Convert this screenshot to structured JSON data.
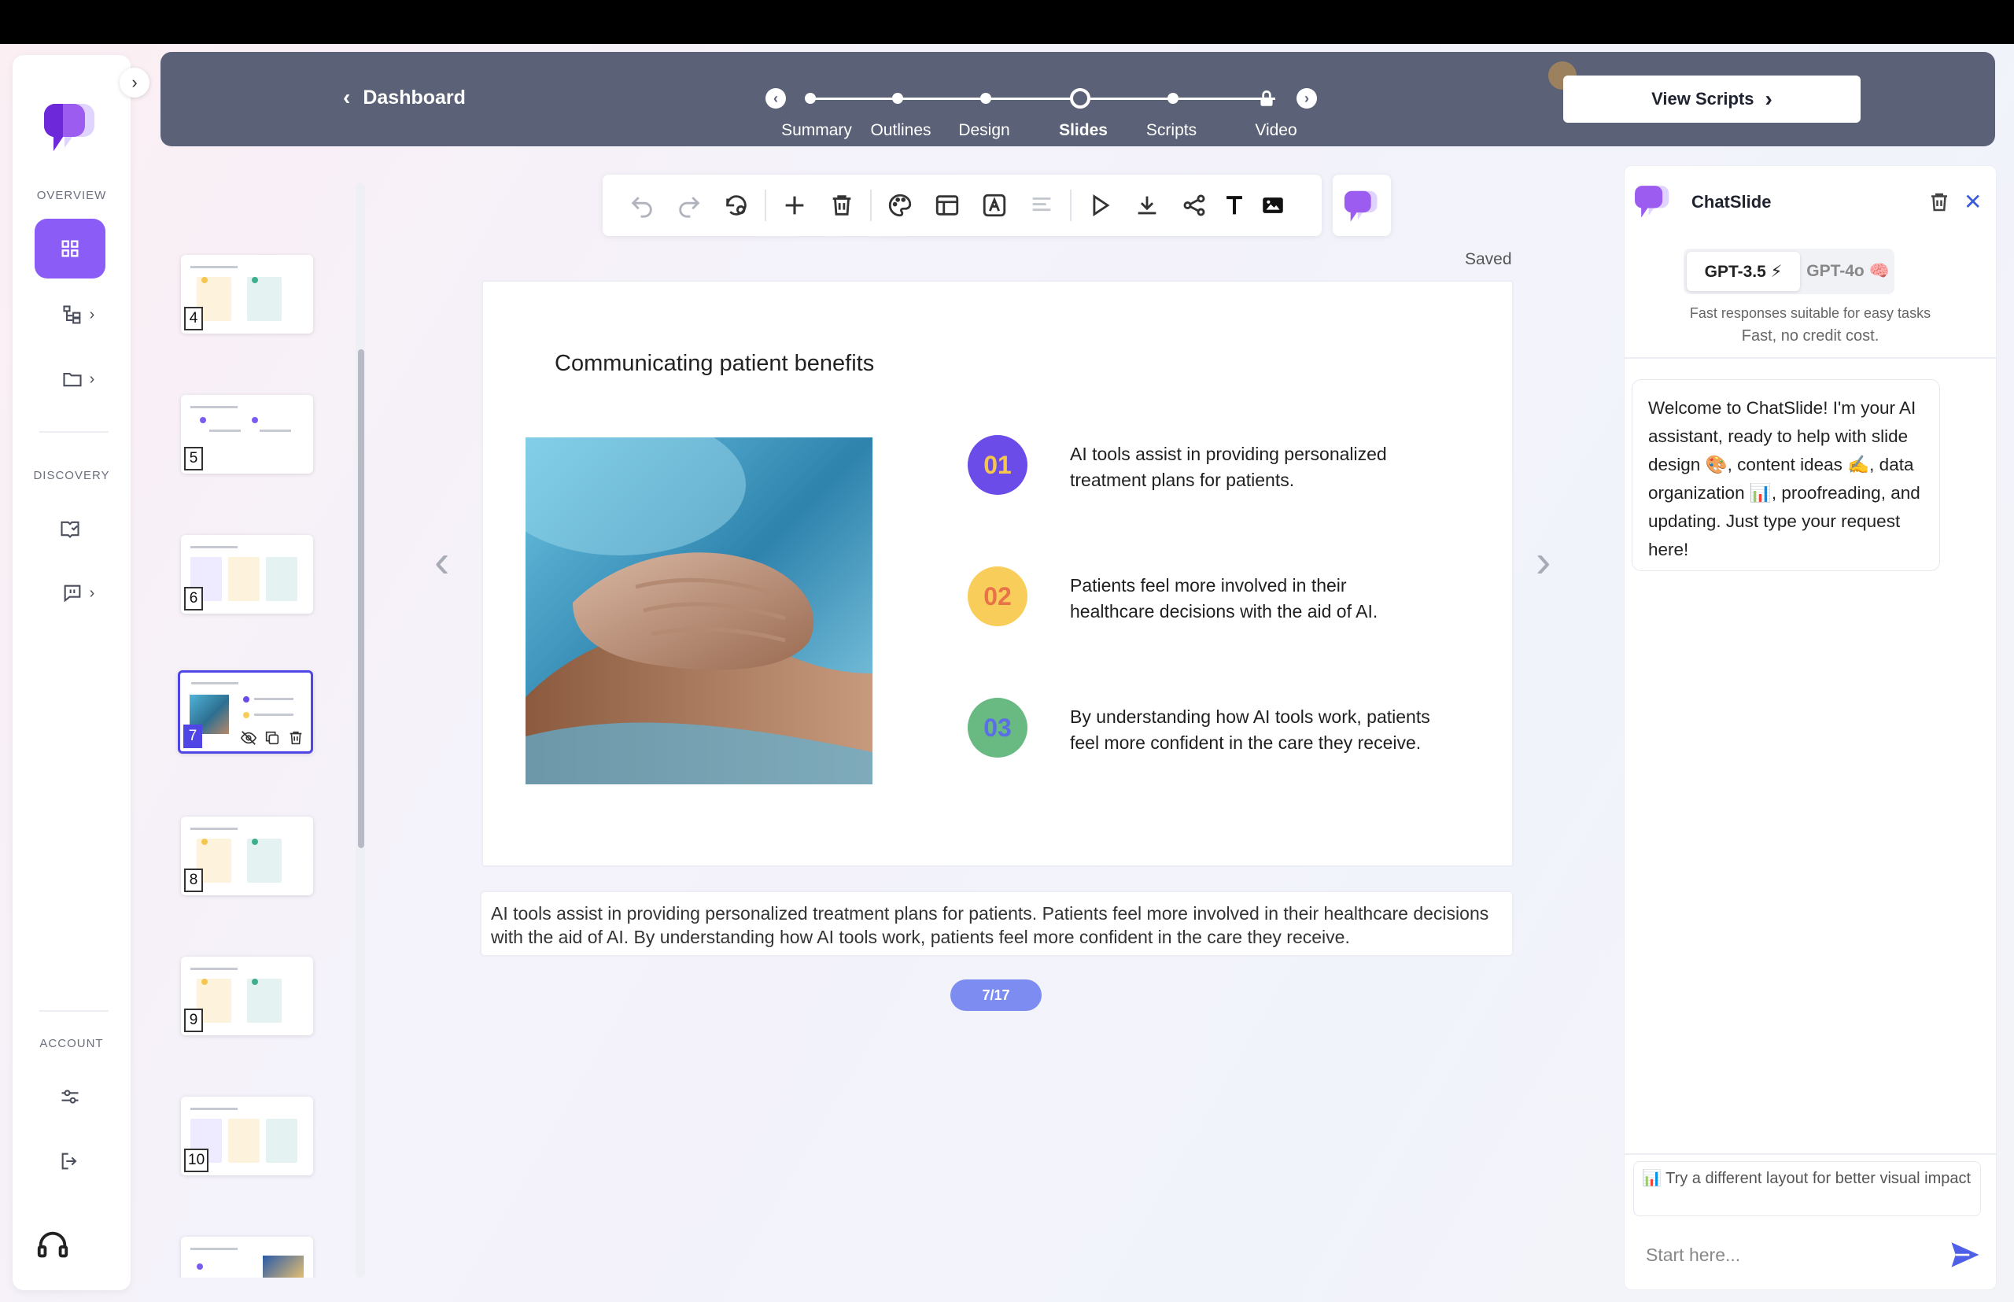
{
  "app": {
    "name": "ChatSlide"
  },
  "sidebar": {
    "sections": [
      {
        "label": "OVERVIEW"
      },
      {
        "label": "DISCOVERY"
      },
      {
        "label": "ACCOUNT"
      }
    ]
  },
  "header": {
    "back_label": "Dashboard",
    "steps": [
      {
        "label": "Summary"
      },
      {
        "label": "Outlines"
      },
      {
        "label": "Design"
      },
      {
        "label": "Slides",
        "current": true
      },
      {
        "label": "Scripts"
      },
      {
        "label": "Video",
        "locked": true
      }
    ],
    "view_scripts_label": "View Scripts"
  },
  "thumbnails": [
    {
      "number": "4"
    },
    {
      "number": "5"
    },
    {
      "number": "6"
    },
    {
      "number": "7",
      "selected": true
    },
    {
      "number": "8"
    },
    {
      "number": "9"
    },
    {
      "number": "10"
    }
  ],
  "editor": {
    "status": "Saved",
    "slide": {
      "title": "Communicating patient benefits",
      "points": [
        {
          "num": "01",
          "text": "AI tools assist in providing personalized treatment plans for patients.",
          "color": "#6c4ce8",
          "text_color": "#f5c64e"
        },
        {
          "num": "02",
          "text": "Patients feel more involved in their healthcare decisions with the aid of AI.",
          "color": "#f9cd5a",
          "text_color": "#e8734a"
        },
        {
          "num": "03",
          "text": "By understanding how AI tools work, patients feel more confident in the care they receive.",
          "color": "#69b982",
          "text_color": "#5b6ee8"
        }
      ]
    },
    "notes": "AI tools assist in providing personalized treatment plans for patients. Patients feel more involved in their healthcare decisions with the aid of AI. By understanding how AI tools work, patients feel more confident in the care they receive.",
    "page_indicator": "7/17"
  },
  "chat": {
    "title": "ChatSlide",
    "models": [
      {
        "label": "GPT-3.5 ⚡",
        "active": true
      },
      {
        "label": "GPT-4o 🧠",
        "active": false
      }
    ],
    "model_desc_1": "Fast responses suitable for easy tasks",
    "model_desc_2": "Fast, no credit cost.",
    "welcome": "Welcome to ChatSlide! I'm your AI assistant, ready to help with slide design 🎨, content ideas ✍️, data organization 📊, proofreading, and updating. Just type your request here!",
    "suggestion": "📊 Try a different layout for better visual impact",
    "input_placeholder": "Start here..."
  },
  "colors": {
    "accent": "#8b5cf6",
    "header_bg": "#5b6176",
    "selection": "#4f46e5"
  }
}
